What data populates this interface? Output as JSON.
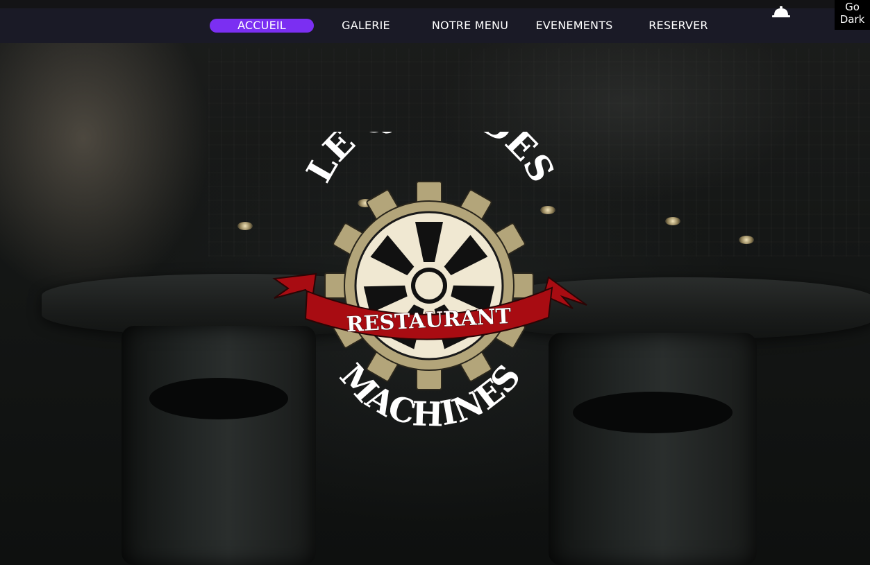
{
  "nav": {
    "items": [
      {
        "label": "ACCUEIL",
        "active": true
      },
      {
        "label": "GALERIE",
        "active": false
      },
      {
        "label": "NOTRE MENU",
        "active": false
      },
      {
        "label": "EVENEMENTS",
        "active": false
      },
      {
        "label": "RESERVER",
        "active": false
      }
    ],
    "active_color": "#7b2ff2",
    "bar_color": "#1a1a26"
  },
  "theme_toggle": {
    "label_line1": "Go",
    "label_line2": "Dark"
  },
  "bell": {
    "icon": "service-bell-icon"
  },
  "logo": {
    "top_text": "LE QUAI DES",
    "banner_text": "RESTAURANT",
    "bottom_text": "MACHINES",
    "gear_color": "#b3a57a",
    "wheel_color": "#f0e8d2",
    "banner_color": "#a80c12"
  }
}
